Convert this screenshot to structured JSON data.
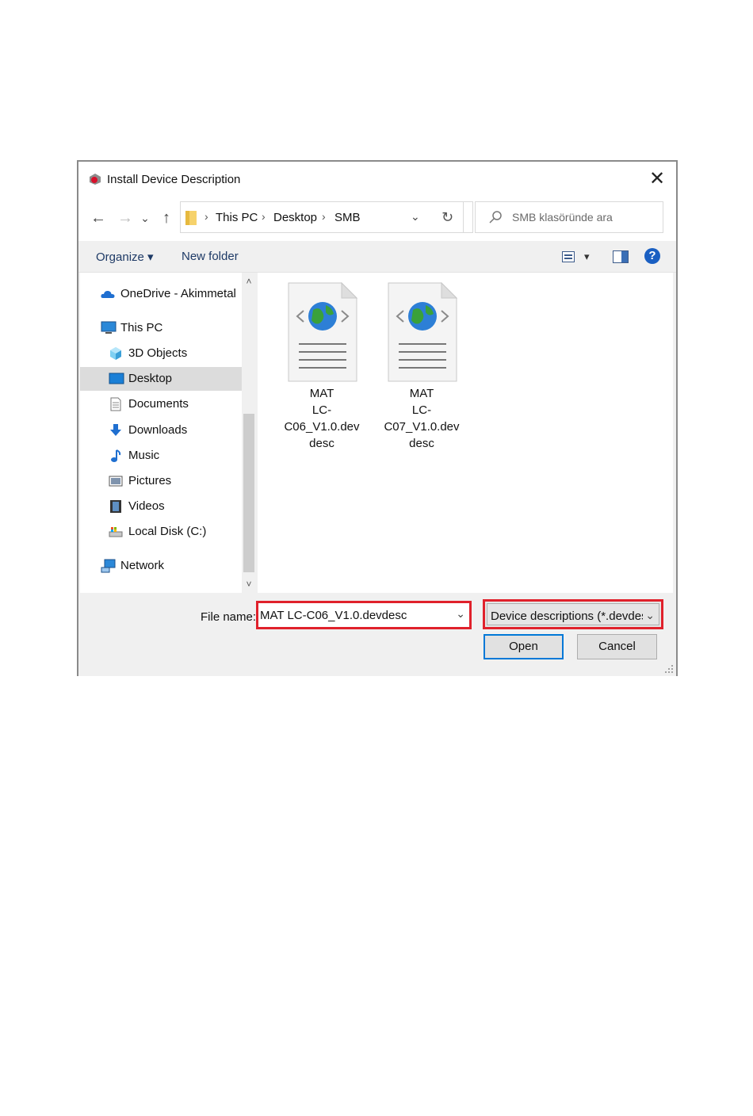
{
  "window": {
    "title": "Install Device Description",
    "close_glyph": "✕"
  },
  "nav": {
    "back": "←",
    "forward": "→",
    "recent": "⌄",
    "up": "↑"
  },
  "address": {
    "crumbs": [
      "This PC",
      "Desktop",
      "SMB"
    ],
    "separator": "›",
    "dropdown": "⌄",
    "refresh": "↻"
  },
  "search": {
    "placeholder": "SMB klasöründe ara"
  },
  "toolbar": {
    "organize_label": "Organize ▾",
    "new_folder_label": "New folder",
    "view_dd": "▾",
    "help": "?"
  },
  "sidebar": {
    "items": [
      {
        "label": "OneDrive - Akimmetal",
        "icon": "cloud-icon"
      },
      {
        "label": "This PC",
        "icon": "computer-icon"
      },
      {
        "label": "3D Objects",
        "icon": "cube-icon"
      },
      {
        "label": "Desktop",
        "icon": "desktop-icon",
        "selected": true
      },
      {
        "label": "Documents",
        "icon": "document-icon"
      },
      {
        "label": "Downloads",
        "icon": "download-icon"
      },
      {
        "label": "Music",
        "icon": "music-note-icon"
      },
      {
        "label": "Pictures",
        "icon": "picture-icon"
      },
      {
        "label": "Videos",
        "icon": "film-icon"
      },
      {
        "label": "Local Disk (C:)",
        "icon": "drive-icon"
      },
      {
        "label": "Network",
        "icon": "network-icon"
      }
    ],
    "scroll_up": "˄",
    "scroll_down": "˅"
  },
  "files": [
    {
      "name": "MAT\nLC-C06_V1.0.dev\ndesc",
      "icon": "xml-web-file-icon"
    },
    {
      "name": "MAT\nLC-C07_V1.0.dev\ndesc",
      "icon": "xml-web-file-icon"
    }
  ],
  "bottom": {
    "file_name_label": "File name:",
    "file_name_value": "MAT LC-C06_V1.0.devdesc",
    "file_name_dd": "⌄",
    "file_type": "Device descriptions (*.devdesc.x",
    "file_type_dd": "⌄",
    "open_label": "Open",
    "cancel_label": "Cancel"
  },
  "colors": {
    "highlight_border": "#e0212b",
    "accent": "#0078d7",
    "selection": "#dcdcdc"
  }
}
